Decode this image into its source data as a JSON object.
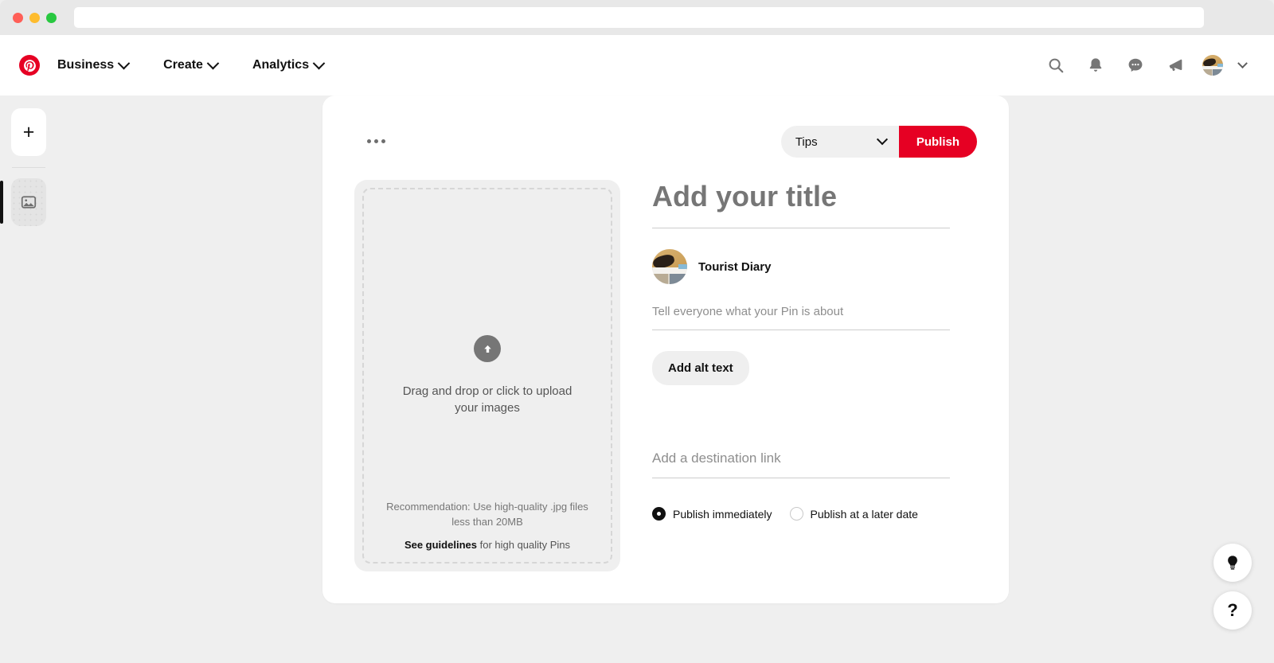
{
  "browser": {
    "url_value": "",
    "url_placeholder": "",
    "traffic_lights": [
      "close",
      "minimize",
      "maximize"
    ]
  },
  "header": {
    "logo_icon": "pinterest-logo-icon",
    "nav": [
      {
        "label": "Business",
        "icon": "chevron-down-icon"
      },
      {
        "label": "Create",
        "icon": "chevron-down-icon"
      },
      {
        "label": "Analytics",
        "icon": "chevron-down-icon"
      }
    ],
    "actions": [
      {
        "name": "search-icon"
      },
      {
        "name": "bell-icon"
      },
      {
        "name": "messages-icon"
      },
      {
        "name": "megaphone-icon"
      }
    ],
    "account": {
      "avatar_icon": "avatar",
      "chevron_icon": "chevron-down-icon"
    }
  },
  "left_rail": {
    "add_label": "+",
    "add_icon": "plus-icon",
    "image_icon": "image-icon",
    "selected_index": 1
  },
  "toolbar": {
    "more_icon": "more-options-icon",
    "tips_selected": "Tips",
    "tips_options": [
      "Tips"
    ],
    "tips_chevron_icon": "chevron-down-icon",
    "publish_label": "Publish"
  },
  "uploader": {
    "arrow_icon": "upload-arrow-icon",
    "instruction": "Drag and drop or click to upload your images",
    "recommendation": "Recommendation: Use high-quality .jpg files less than 20MB",
    "guidelines_link": "See guidelines",
    "guidelines_rest": " for high quality Pins"
  },
  "form": {
    "title_value": "",
    "title_placeholder": "Add your title",
    "board_name": "Tourist Diary",
    "board_avatar_icon": "board-avatar",
    "description_value": "",
    "description_placeholder": "Tell everyone what your Pin is about",
    "alt_text_label": "Add alt text",
    "link_value": "",
    "link_placeholder": "Add a destination link",
    "schedule_options": [
      {
        "label": "Publish immediately",
        "selected": true
      },
      {
        "label": "Publish at a later date",
        "selected": false
      }
    ]
  },
  "floating": {
    "idea_icon": "lightbulb-icon",
    "help_icon": "question-mark-icon",
    "help_label": "?"
  },
  "colors": {
    "brand_red": "#e60023",
    "page_background": "#efefef",
    "card_background": "#ffffff",
    "muted_text": "#767676"
  }
}
